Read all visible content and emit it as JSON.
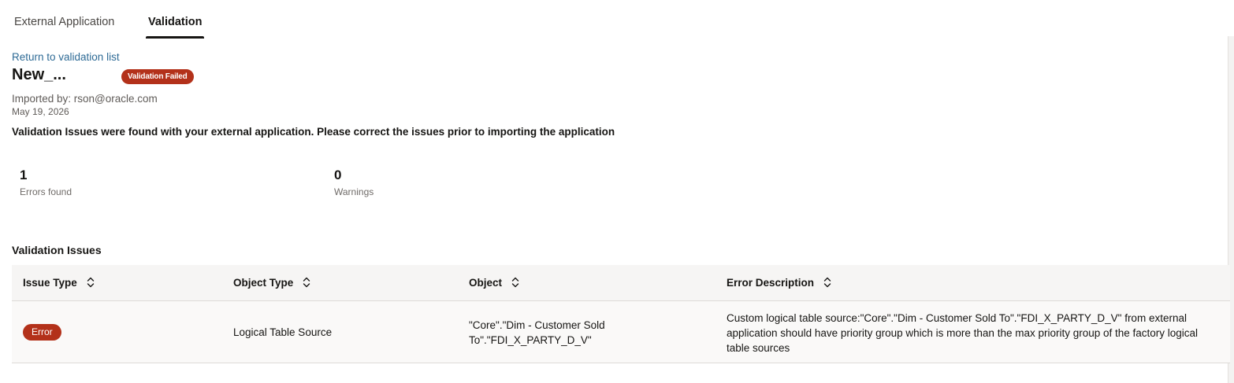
{
  "tabs": [
    {
      "label": "External Application",
      "active": false
    },
    {
      "label": "Validation",
      "active": true
    }
  ],
  "return_link": "Return to validation list",
  "header": {
    "title": "New_...",
    "status_badge": "Validation Failed",
    "imported_by": "Imported by: rson@oracle.com",
    "date": "May 19, 2026"
  },
  "message": "Validation Issues were found with your external application. Please correct the issues prior to importing the application",
  "metrics": {
    "errors": {
      "value": "1",
      "label": "Errors found"
    },
    "warnings": {
      "value": "0",
      "label": "Warnings"
    }
  },
  "issues": {
    "title": "Validation Issues",
    "columns": [
      "Issue Type",
      "Object Type",
      "Object",
      "Error Description"
    ],
    "rows": [
      {
        "issue_type": "Error",
        "object_type": "Logical Table Source",
        "object": "\"Core\".\"Dim - Customer Sold To\".\"FDI_X_PARTY_D_V\"",
        "error_description": "Custom logical table source:\"Core\".\"Dim - Customer Sold To\".\"FDI_X_PARTY_D_V\" from external application should have priority group which is more than the max priority group of the factory logical table sources"
      }
    ]
  },
  "colors": {
    "accent_link": "#2d6a95",
    "error": "#b3311a",
    "header_bg": "#f6f5f4"
  },
  "icons": {
    "sort": "sort-updown-icon"
  }
}
